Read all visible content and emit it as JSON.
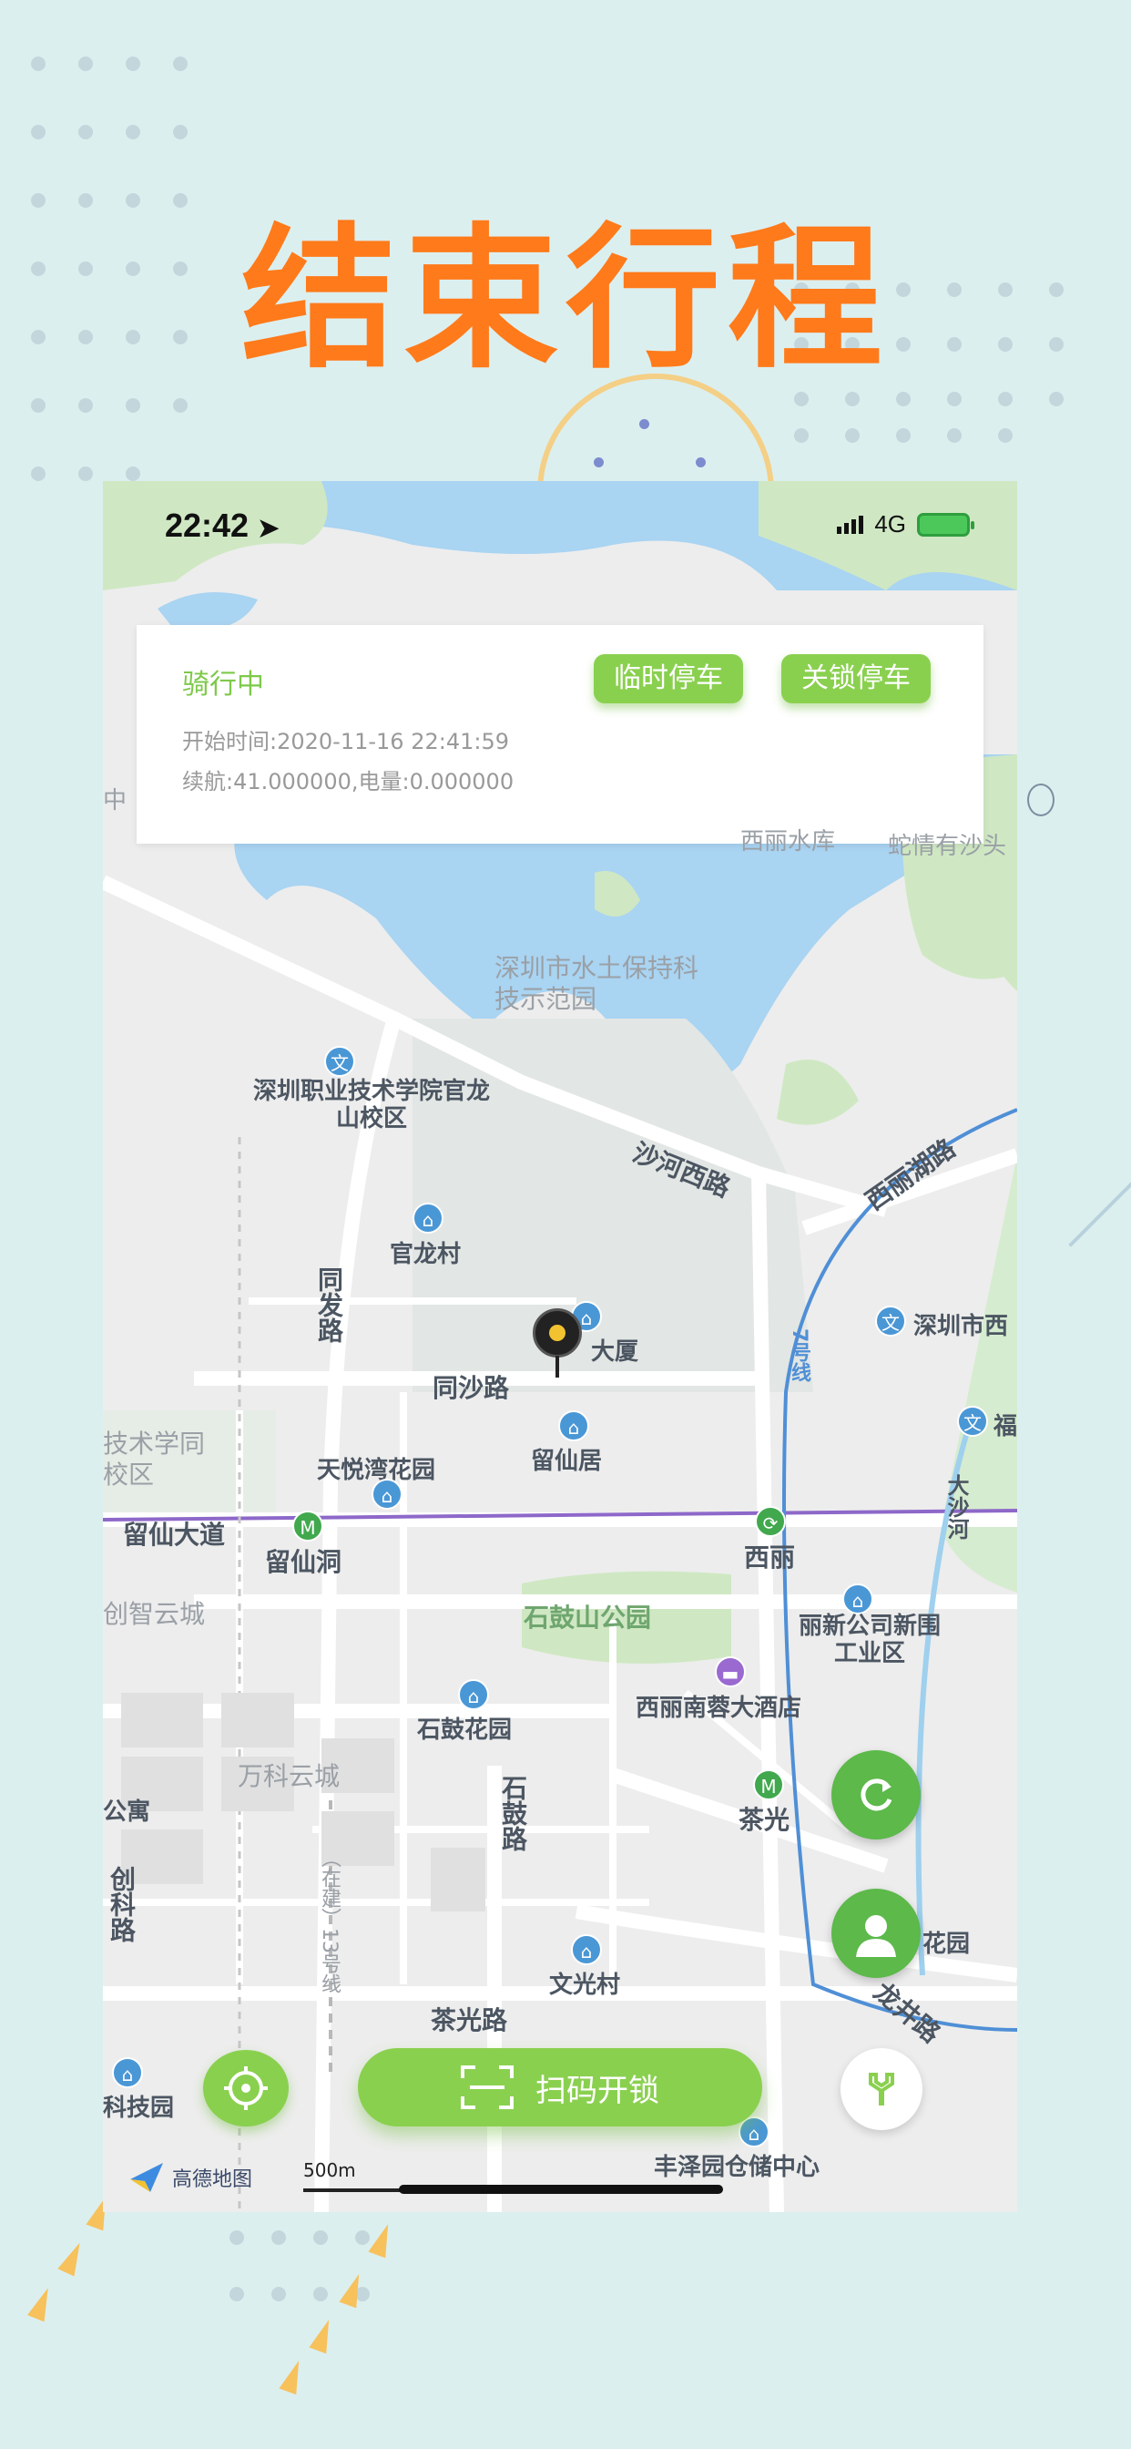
{
  "headline": "结束行程",
  "status_bar": {
    "time": "22:42",
    "network": "4G"
  },
  "ride_card": {
    "status": "骑行中",
    "start_time": "开始时间:2020-11-16 22:41:59",
    "range_battery": "续航:41.000000,电量:0.000000",
    "temp_park_label": "临时停车",
    "lock_park_label": "关锁停车"
  },
  "map": {
    "labels": {
      "park": "深圳市水土保持科技示范园",
      "college": "深圳职业技术学院官龙山校区",
      "shahe_road": "沙河西路",
      "xili_lake_road": "西丽湖路",
      "guanlong": "官龙村",
      "tongfa_road": "同发路",
      "tongsha_road": "同沙路",
      "building": "大厦",
      "sz_west": "深圳市西",
      "fu": "福",
      "tianyue": "天悦湾花园",
      "liuxianju": "留仙居",
      "line7": "7号线",
      "tech_school": "技术学同校区",
      "liuxian_ave": "留仙大道",
      "liuxian_dong": "留仙洞",
      "xili": "西丽",
      "dasha": "大沙河",
      "zhiyun": "创智云城",
      "shigu_park": "石鼓山公园",
      "lixin": "丽新公司新围工业区",
      "xili_hotel": "西丽南蓉大酒店",
      "shigu_garden": "石鼓花园",
      "wanke": "万科云城",
      "apartment": "公寓",
      "shigu_road": "石鼓路",
      "chaguang": "茶光",
      "chuangke_road": "创科路",
      "line13": "（在建）13号线",
      "garden": "花园",
      "wenguang": "文光村",
      "longjing_road": "龙井路",
      "chaguang_road": "茶光路",
      "tech_garden": "科技园",
      "fengze": "丰泽园仓储中心",
      "xili_reservoir": "西丽水库",
      "shuai": "蛇情有沙头",
      "left_zhong": "中"
    },
    "logo_text": "高德地图",
    "scale_text": "500m"
  },
  "scan_button_label": "扫码开锁",
  "colors": {
    "accent_green": "#8ad04f",
    "headline_orange": "#ff7a1a"
  }
}
